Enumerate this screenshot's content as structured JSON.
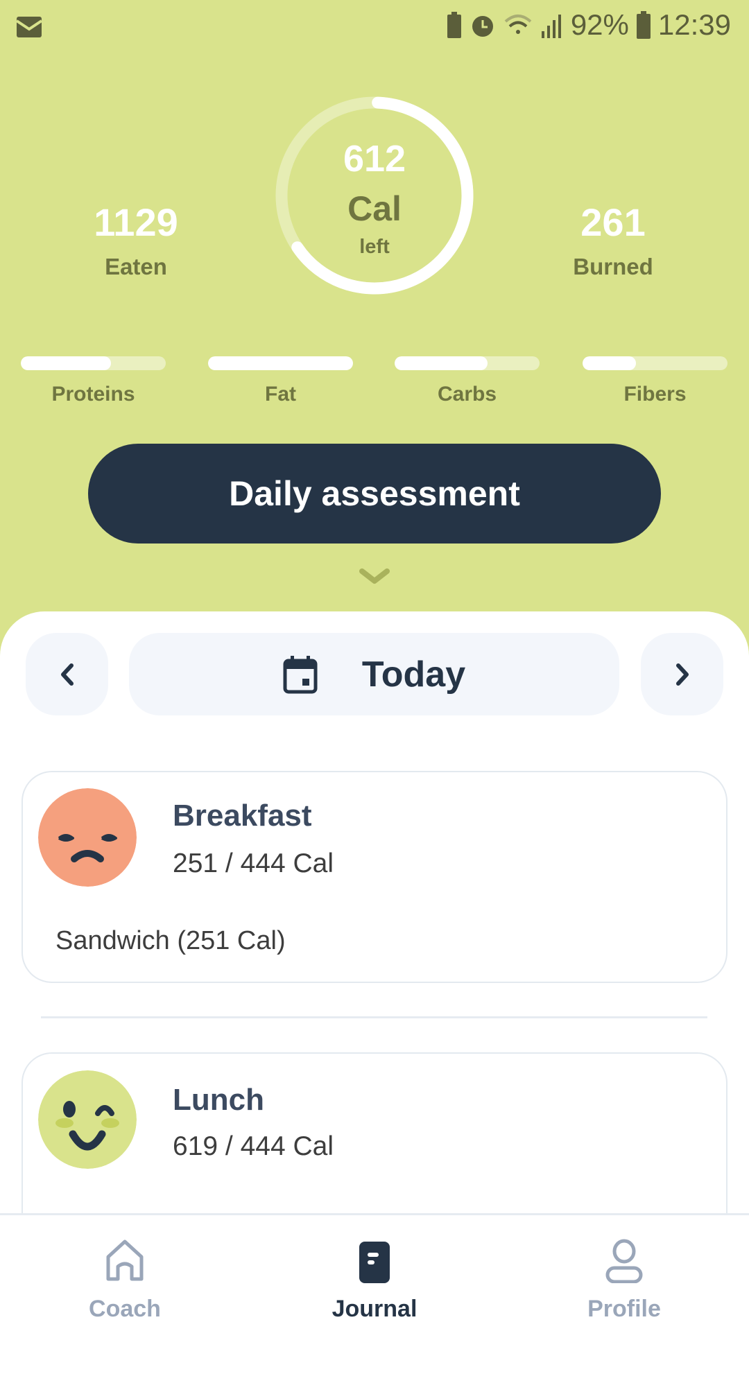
{
  "status_bar": {
    "battery": "92%",
    "time": "12:39",
    "icons": [
      "email-icon",
      "battery-saver-icon",
      "alarm-icon",
      "wifi-icon",
      "signal-icon",
      "battery-icon"
    ]
  },
  "summary": {
    "calories_left": "612",
    "calories_unit": "Cal",
    "calories_left_label": "left",
    "ring_progress": 0.65,
    "eaten_value": "1129",
    "eaten_label": "Eaten",
    "burned_value": "261",
    "burned_label": "Burned"
  },
  "macros": [
    {
      "label": "Proteins",
      "progress": 0.62
    },
    {
      "label": "Fat",
      "progress": 1.0
    },
    {
      "label": "Carbs",
      "progress": 0.64
    },
    {
      "label": "Fibers",
      "progress": 0.37
    }
  ],
  "daily_assessment_label": "Daily assessment",
  "date_nav": {
    "label": "Today"
  },
  "meals": [
    {
      "title": "Breakfast",
      "calories": "251 / 444 Cal",
      "items": [
        "Sandwich (251 Cal)"
      ],
      "mood": "sad",
      "color": "#f5a07e"
    },
    {
      "title": "Lunch",
      "calories": "619 / 444 Cal",
      "mood": "wink",
      "color": "#d9e38c"
    }
  ],
  "bottom_nav": [
    {
      "label": "Coach",
      "icon": "home-icon",
      "active": false
    },
    {
      "label": "Journal",
      "icon": "journal-icon",
      "active": true
    },
    {
      "label": "Profile",
      "icon": "profile-icon",
      "active": false
    }
  ],
  "colors": {
    "header_bg": "#d9e38c",
    "primary_dark": "#253446",
    "inactive": "#9aa6b9"
  }
}
